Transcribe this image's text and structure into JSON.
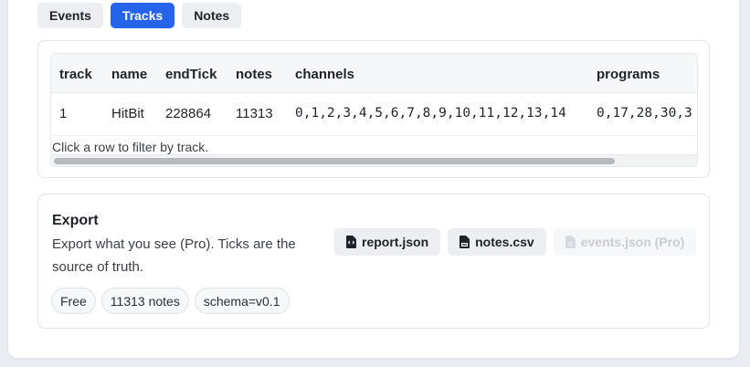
{
  "tabs": [
    {
      "label": "Events",
      "active": false
    },
    {
      "label": "Tracks",
      "active": true
    },
    {
      "label": "Notes",
      "active": false
    }
  ],
  "tracks_table": {
    "columns": [
      "track",
      "name",
      "endTick",
      "notes",
      "channels",
      "programs"
    ],
    "rows": [
      [
        "1",
        "HitBit",
        "228864",
        "11313",
        "0,1,2,3,4,5,6,7,8,9,10,11,12,13,14",
        "0,17,28,30,3"
      ]
    ],
    "hint": "Click a row to filter by track."
  },
  "export": {
    "title": "Export",
    "description": "Export what you see (Pro). Ticks are the source of truth.",
    "buttons": [
      {
        "label": "report.json",
        "icon": "json-file-icon",
        "disabled": false
      },
      {
        "label": "notes.csv",
        "icon": "csv-file-icon",
        "disabled": false
      },
      {
        "label": "events.json (Pro)",
        "icon": "file-icon",
        "disabled": true
      }
    ],
    "chips": [
      "Free",
      "11313 notes",
      "schema=v0.1"
    ]
  },
  "colors": {
    "accent": "#2563eb",
    "tab_bg": "#eceef1",
    "disabled_text": "#c9ccd1"
  }
}
